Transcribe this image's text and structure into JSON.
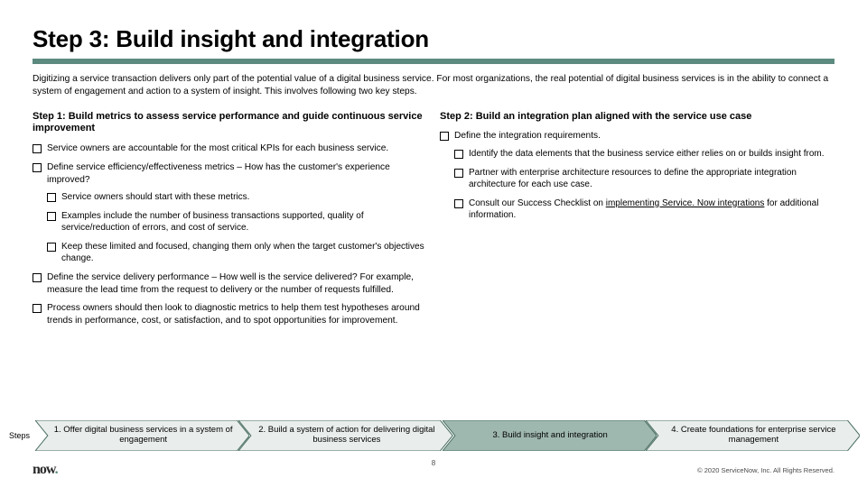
{
  "title": "Step 3: Build insight and integration",
  "intro": "Digitizing a service transaction delivers only part of the potential value of a digital business service. For most organizations, the real potential of digital business services is in the ability to connect a system of engagement and action to a system of insight. This involves following two key steps.",
  "left": {
    "heading": "Step 1: Build metrics to assess service performance and guide continuous service improvement",
    "items": [
      {
        "text": "Service owners are accountable for the most critical KPIs for each business service."
      },
      {
        "text": "Define service efficiency/effectiveness metrics – How has the customer's experience improved?",
        "sub": [
          "Service owners should start with these metrics.",
          "Examples include the number of business transactions supported, quality of service/reduction of errors, and cost of service.",
          "Keep these limited and focused, changing them only when the target customer's objectives change."
        ]
      },
      {
        "text": "Define the service delivery performance – How well is the service delivered? For example, measure the lead time from the request to delivery or the number of requests fulfilled."
      },
      {
        "text": "Process owners should then look to diagnostic metrics to help them test hypotheses around trends in performance, cost, or satisfaction, and to spot opportunities for improvement."
      }
    ]
  },
  "right": {
    "heading": "Step 2: Build an integration plan aligned with the service use case",
    "items": [
      {
        "text": "Define the integration requirements.",
        "sub": [
          "Identify the data elements that the business service either relies on or builds insight from.",
          "Partner with enterprise architecture resources to define the appropriate integration architecture for each use case.",
          {
            "prefix": "Consult our Success Checklist on ",
            "link": "implementing Service. Now integrations",
            "suffix": " for additional information."
          }
        ]
      }
    ]
  },
  "steps_label": "Steps",
  "steps": [
    {
      "label": "1. Offer digital business services in a system of engagement",
      "active": false
    },
    {
      "label": "2. Build a system of action for delivering digital business services",
      "active": false
    },
    {
      "label": "3. Build insight and integration",
      "active": true
    },
    {
      "label": "4. Create foundations for enterprise service management",
      "active": false
    }
  ],
  "page_number": "8",
  "logo_text": "now",
  "copyright": "© 2020 ServiceNow, Inc. All Rights Reserved."
}
